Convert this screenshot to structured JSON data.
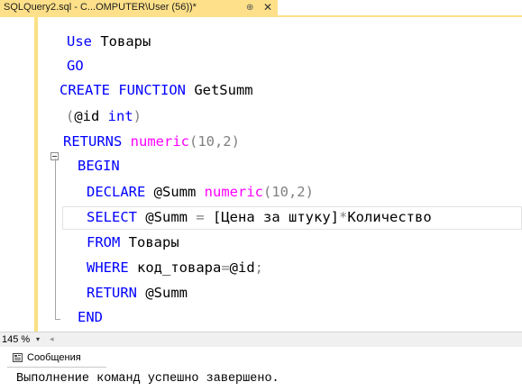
{
  "tab": {
    "title": "SQLQuery2.sql - C...OMPUTER\\User (56))*",
    "pin": "⊕",
    "close": "✕"
  },
  "code": {
    "line1": {
      "kw": "Use",
      "rest": " Товары"
    },
    "line2": {
      "kw": "GO"
    },
    "line3": {
      "kw": "CREATE FUNCTION",
      "rest": " GetSumm"
    },
    "line4": {
      "open": "(",
      "var": "@id ",
      "kw": "int",
      "close": ")"
    },
    "line5": {
      "kw": "RETURNS ",
      "fn": "numeric",
      "args": "(10,2)"
    },
    "line6": {
      "kw": "BEGIN"
    },
    "line7": {
      "kw": "DECLARE",
      "var": " @Summ ",
      "fn": "numeric",
      "args": "(10,2)"
    },
    "line8": {
      "kw": "SELECT",
      "var": " @Summ ",
      "eq": "=",
      "col": " [Цена за штуку]",
      "mul": "*",
      "rest": "Количество"
    },
    "line9": {
      "kw": "FROM",
      "rest": " Товары"
    },
    "line10": {
      "kw": "WHERE",
      "rest": " код_товара",
      "eq": "=",
      "var": "@id",
      "semi": ";"
    },
    "line11": {
      "kw": "RETURN",
      "var": " @Summ"
    },
    "line12": {
      "kw": "END"
    }
  },
  "status": {
    "zoom": "145 %",
    "dropdown": "▾",
    "scroll_left": "◂"
  },
  "messages": {
    "tab_label": "Сообщения",
    "text": "Выполнение команд успешно завершено."
  },
  "colors": {
    "keyword": "#0000ff",
    "function": "#ff00ff",
    "operator": "#808080",
    "tab": "#fde089"
  }
}
